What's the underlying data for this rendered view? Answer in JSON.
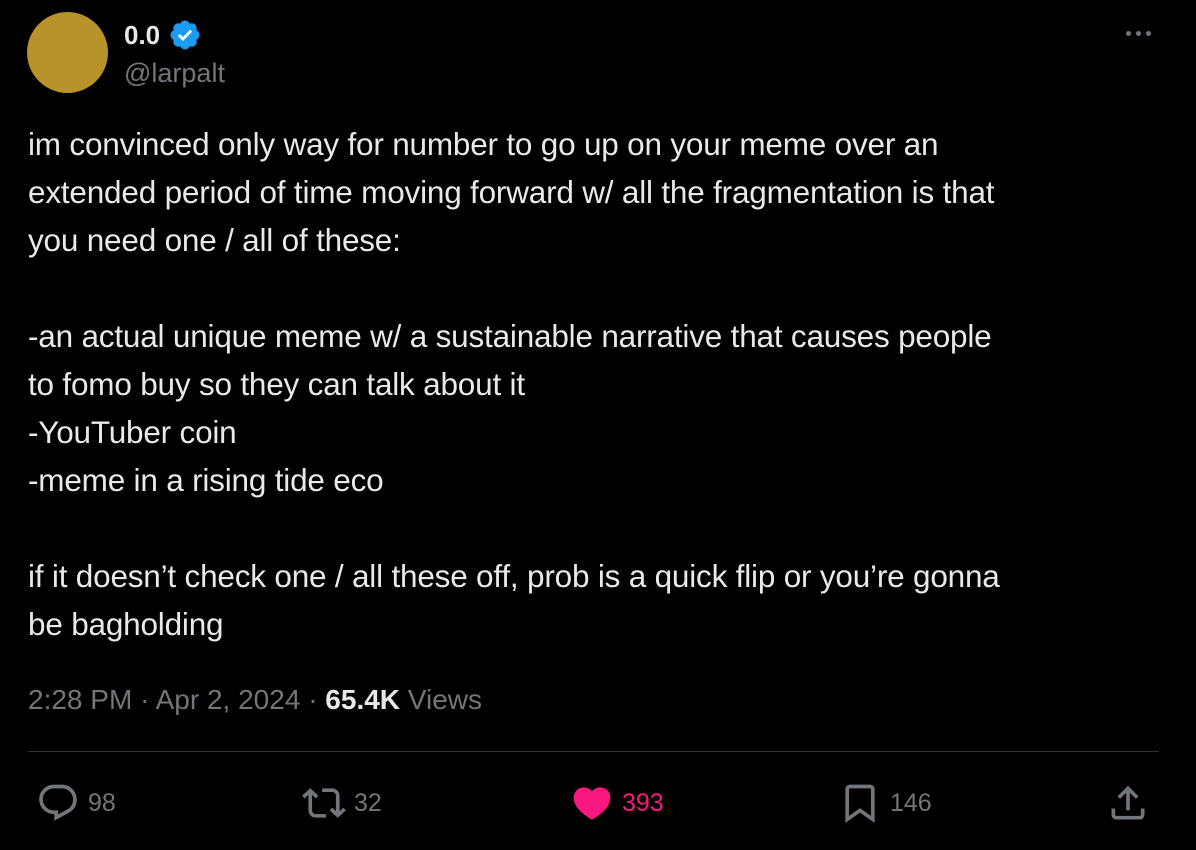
{
  "author": {
    "display_name": "0.0",
    "handle": "@larpalt",
    "verified": true,
    "avatar_color": "#b8922a",
    "verified_color": "#1d9bf0"
  },
  "tweet": {
    "text": "im convinced only way for number to go up on your meme over an\nextended period of time moving forward w/ all the fragmentation is that\nyou need one / all of these:\n\n-an actual unique meme w/ a sustainable narrative that causes people\nto fomo buy so they can talk about it\n-YouTuber coin\n-meme in a rising tide eco\n\nif it doesn’t check one / all these off, prob is a quick flip or you’re gonna\nbe bagholding",
    "time": "2:28 PM",
    "separator": "·",
    "date": "Apr 2, 2024",
    "views_count": "65.4K",
    "views_label": "Views"
  },
  "actions": {
    "replies": "98",
    "reposts": "32",
    "likes": "393",
    "bookmarks": "146",
    "like_color": "#f91880"
  },
  "icons": {
    "more": "more-horizontal-icon",
    "reply": "reply-icon",
    "repost": "repost-icon",
    "like": "heart-icon",
    "bookmark": "bookmark-icon",
    "share": "share-icon",
    "verified": "verified-badge-icon"
  }
}
